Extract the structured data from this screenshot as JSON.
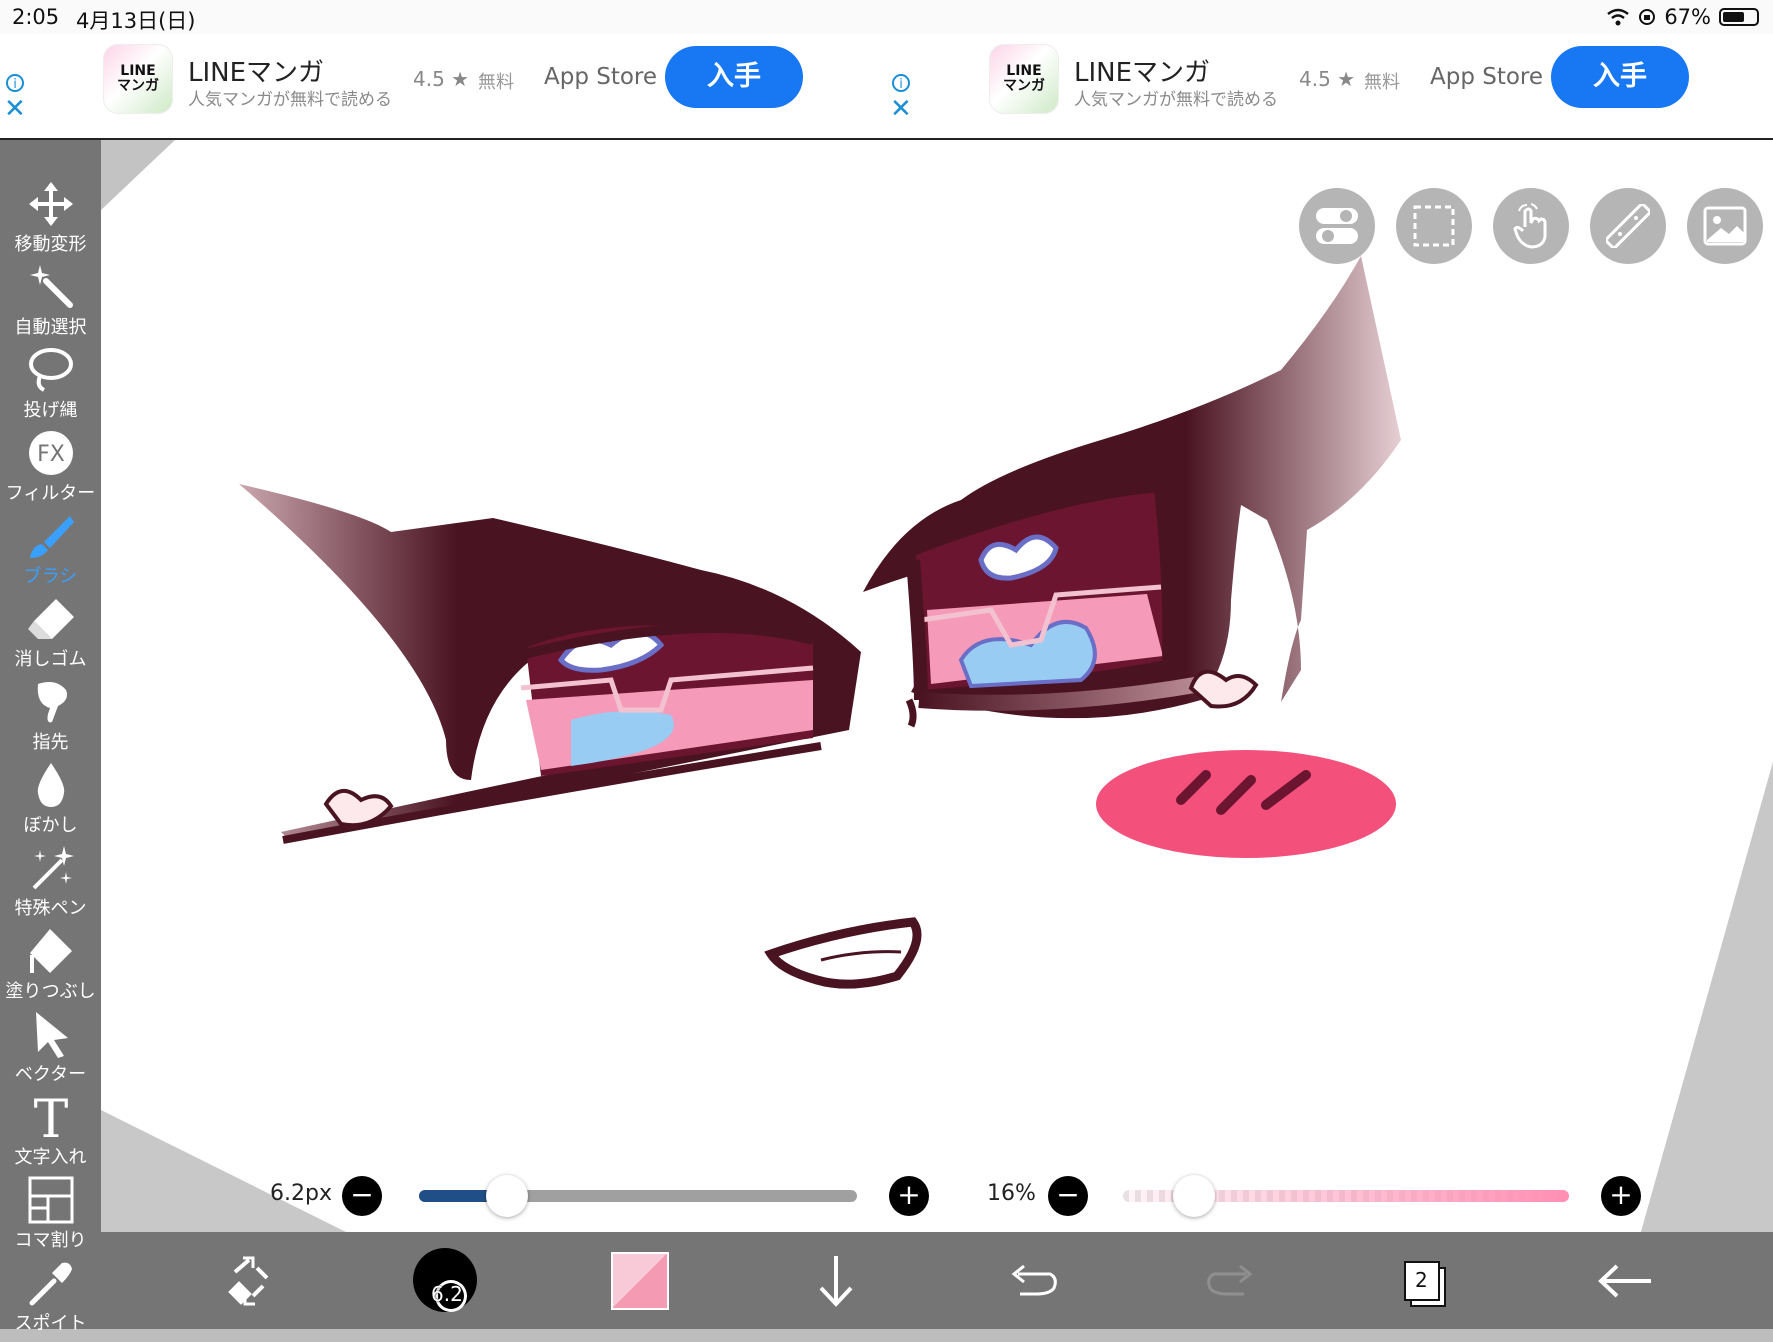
{
  "status": {
    "time": "2:05",
    "date": "4月13日(日)",
    "battery": "67%",
    "battery_level": 0.67
  },
  "ads": [
    {
      "icon_text": "LINE\nマンガ",
      "name": "LINEマンガ",
      "subtitle": "人気マンガが無料で読める",
      "rating": "4.5 ★",
      "price": "無料",
      "store": "App Store",
      "button": "入手"
    },
    {
      "icon_text": "LINE\nマンガ",
      "name": "LINEマンガ",
      "subtitle": "人気マンガが無料で読める",
      "rating": "4.5 ★",
      "price": "無料",
      "store": "App Store",
      "button": "入手"
    }
  ],
  "tools": [
    {
      "id": "move",
      "label": "移動変形",
      "icon": "move-arrows-icon"
    },
    {
      "id": "autoselect",
      "label": "自動選択",
      "icon": "magic-wand-icon"
    },
    {
      "id": "lasso",
      "label": "投げ縄",
      "icon": "lasso-icon"
    },
    {
      "id": "filter",
      "label": "フィルター",
      "icon": "fx-icon",
      "icon_text": "FX"
    },
    {
      "id": "brush",
      "label": "ブラシ",
      "icon": "brush-icon",
      "active": true
    },
    {
      "id": "eraser",
      "label": "消しゴム",
      "icon": "eraser-icon"
    },
    {
      "id": "finger",
      "label": "指先",
      "icon": "smudge-finger-icon"
    },
    {
      "id": "blur",
      "label": "ぼかし",
      "icon": "blur-drop-icon"
    },
    {
      "id": "specialpen",
      "label": "特殊ペン",
      "icon": "sparkle-pen-icon"
    },
    {
      "id": "fill",
      "label": "塗りつぶし",
      "icon": "bucket-fill-icon"
    },
    {
      "id": "vector",
      "label": "ベクター",
      "icon": "cursor-arrow-icon"
    },
    {
      "id": "text",
      "label": "文字入れ",
      "icon": "text-t-icon",
      "icon_text": "T"
    },
    {
      "id": "frame",
      "label": "コマ割り",
      "icon": "panel-frame-icon"
    },
    {
      "id": "eyedropper",
      "label": "スポイト",
      "icon": "eyedropper-icon"
    }
  ],
  "quick_buttons": [
    "toggle-switch-icon",
    "selection-rect-icon",
    "hand-touch-icon",
    "ruler-icon",
    "image-icon"
  ],
  "brush_size": {
    "label": "6.2px",
    "fraction": 0.2
  },
  "opacity": {
    "label": "16%",
    "fraction": 0.16
  },
  "bottom_bar": {
    "brush_badge": "6.2",
    "layer_count": "2"
  },
  "colors": {
    "accent": "#3aa0ff",
    "ad_button": "#1877f2",
    "toolbar": "#757575",
    "eye_dark": "#4a1322",
    "iris": "#6b1530",
    "iris_pink": "#f59ab8",
    "iris_blue": "#99ccf2",
    "blush": "#f4507c"
  }
}
